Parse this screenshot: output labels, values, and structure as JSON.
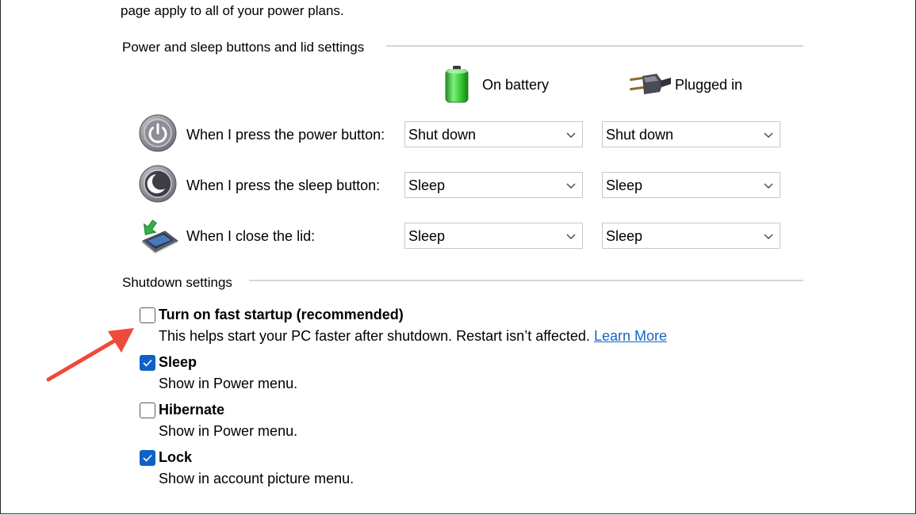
{
  "intro_text": "page apply to all of your power plans.",
  "buttons_section": {
    "title": "Power and sleep buttons and lid settings",
    "columns": {
      "battery": "On battery",
      "plugged": "Plugged in"
    },
    "rows": [
      {
        "label": "When I press the power button:",
        "icon": "power-button-icon",
        "battery_value": "Shut down",
        "plugged_value": "Shut down"
      },
      {
        "label": "When I press the sleep button:",
        "icon": "sleep-button-icon",
        "battery_value": "Sleep",
        "plugged_value": "Sleep"
      },
      {
        "label": "When I close the lid:",
        "icon": "laptop-lid-icon",
        "battery_value": "Sleep",
        "plugged_value": "Sleep"
      }
    ]
  },
  "shutdown_section": {
    "title": "Shutdown settings",
    "options": [
      {
        "title": "Turn on fast startup (recommended)",
        "description": "This helps start your PC faster after shutdown. Restart isn’t affected.",
        "link": "Learn More",
        "checked": false
      },
      {
        "title": "Sleep",
        "description": "Show in Power menu.",
        "checked": true
      },
      {
        "title": "Hibernate",
        "description": "Show in Power menu.",
        "checked": false
      },
      {
        "title": "Lock",
        "description": "Show in account picture menu.",
        "checked": true
      }
    ]
  },
  "colors": {
    "checkbox_checked": "#0f61c8",
    "link": "#1466c4",
    "annotation_arrow": "#ee4a3b"
  }
}
